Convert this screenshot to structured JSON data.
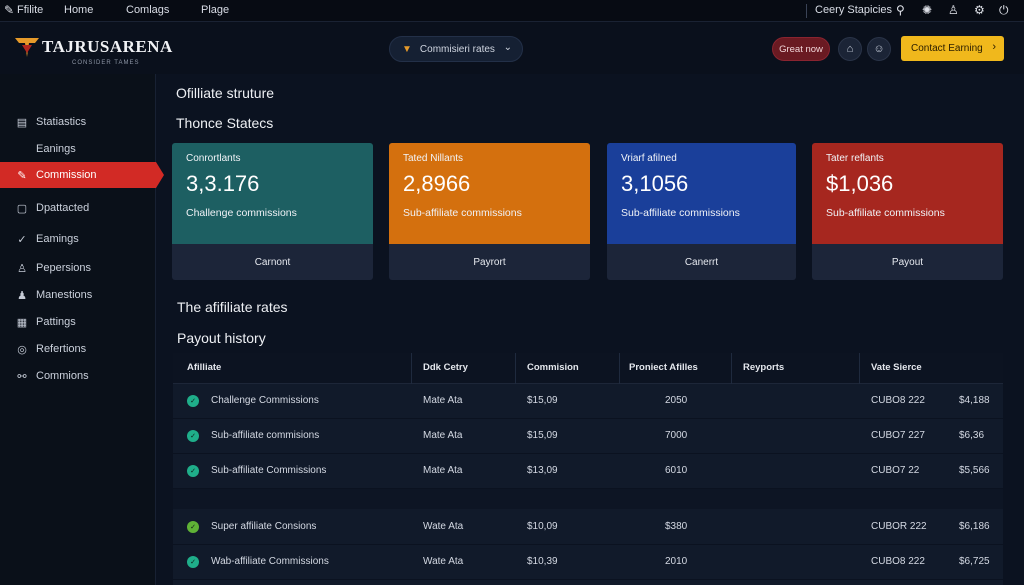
{
  "menubar": {
    "app_icon": "pencil-icon",
    "items": [
      "Ffilite",
      "Home",
      "Comlags",
      "Plage"
    ],
    "right_label": "Ceery Stapicies",
    "right_icons": [
      "pen-icon",
      "bug-icon",
      "user-icon",
      "gear-icon",
      "power-icon"
    ]
  },
  "header": {
    "logo_text": "TAJRUSARENA",
    "logo_sub": "CONSIDER TAMES",
    "select_value": "Commisieri rates",
    "great_button": "Great now",
    "icon_buttons": [
      "bank-icon",
      "smile-icon"
    ],
    "contact_button": "Contact Earning",
    "colors": {
      "accent": "#f0b81c",
      "danger": "#d22a25"
    }
  },
  "sidebar": {
    "items": [
      {
        "label": "Statiastics",
        "icon": "chart-icon",
        "active": false
      },
      {
        "label": "Eanings",
        "icon": "",
        "active": false
      },
      {
        "label": "Commission",
        "icon": "edit-icon",
        "active": true
      },
      {
        "label": "Dpattacted",
        "icon": "doc-icon",
        "active": false
      },
      {
        "label": "Eamings",
        "icon": "check-icon",
        "active": false
      },
      {
        "label": "Pepersions",
        "icon": "person-icon",
        "active": false
      },
      {
        "label": "Manestions",
        "icon": "people-icon",
        "active": false
      },
      {
        "label": "Pattings",
        "icon": "grid-icon",
        "active": false
      },
      {
        "label": "Refertions",
        "icon": "target-icon",
        "active": false
      },
      {
        "label": "Commions",
        "icon": "link-icon",
        "active": false
      }
    ]
  },
  "main": {
    "structure_title": "Ofilliate struture",
    "states_title": "Thonce Statecs",
    "cards": [
      {
        "label": "Conrortlants",
        "value": "3,3.176",
        "sub": "Challenge commissions",
        "footer": "Carnont",
        "color": "#1d5f62"
      },
      {
        "label": "Tated Nillants",
        "value": "2,8966",
        "sub": "Sub-affiliate commissions",
        "footer": "Payrort",
        "color": "#d4700e"
      },
      {
        "label": "Vriarf afilned",
        "value": "3,1056",
        "sub": "Sub-affiliate commissions",
        "footer": "Canerrt",
        "color": "#1a3f9a"
      },
      {
        "label": "Tater reflants",
        "value": "$1,036",
        "sub": "Sub-affiliate commissions",
        "footer": "Payout",
        "color": "#a6271f"
      }
    ],
    "rates_title": "The afifiliate rates",
    "history_title": "Payout history",
    "table": {
      "headers": [
        "Afilliate",
        "Ddk Cetry",
        "Commision",
        "Proniect Afilles",
        "Reyports",
        "Vate Sierce"
      ],
      "rows": [
        {
          "name": "Challenge Commissions",
          "mark": "Mate Ata",
          "commission": "$15,09",
          "count": "2050",
          "code": "CUBO8 222",
          "amount": "$4,188",
          "dot": "teal"
        },
        {
          "name": "Sub-affiliate commisions",
          "mark": "Mate Ata",
          "commission": "$15,09",
          "count": "7000",
          "code": "CUBO7 227",
          "amount": "$6,36",
          "dot": "teal"
        },
        {
          "name": "Sub-affiliate Commissions",
          "mark": "Mate Ata",
          "commission": "$13,09",
          "count": "6010",
          "code": "CUBO7 22",
          "amount": "$5,566",
          "dot": "teal"
        },
        {
          "name": "Super affiliate Consions",
          "mark": "Wate Ata",
          "commission": "$10,09",
          "count": "$380",
          "code": "CUBOR 222",
          "amount": "$6,186",
          "dot": "green"
        },
        {
          "name": "Wab-affiliate Commissions",
          "mark": "Wate Ata",
          "commission": "$10,39",
          "count": "2010",
          "code": "CUBO8 222",
          "amount": "$6,725",
          "dot": "teal"
        }
      ]
    }
  }
}
